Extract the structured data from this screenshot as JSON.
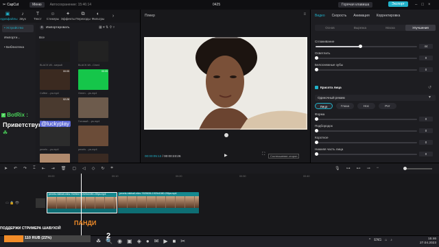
{
  "titlebar": {
    "logo": "CapCut",
    "menu": "Меню",
    "autosave": "Автосохранение: 15:46:14",
    "project": "0425",
    "shortcuts": "Горячая клавиша",
    "export": "Экспорт"
  },
  "tooltabs": [
    {
      "icon": "media-icon",
      "glyph": "▣",
      "label": "Медиафайлы"
    },
    {
      "icon": "audio-icon",
      "glyph": "♪",
      "label": "Звук"
    },
    {
      "icon": "text-icon",
      "glyph": "T",
      "label": "Текст"
    },
    {
      "icon": "sticker-icon",
      "glyph": "☺",
      "label": "Стикеры"
    },
    {
      "icon": "effects-icon",
      "glyph": "✦",
      "label": "Эффекты"
    },
    {
      "icon": "transitions-icon",
      "glyph": "⧉",
      "label": "Переходы"
    },
    {
      "icon": "filters-icon",
      "glyph": "◐",
      "label": "Фильтры"
    },
    {
      "icon": "more-icon",
      "glyph": "›",
      "label": ""
    }
  ],
  "sidebar": {
    "items": [
      "• Устройство",
      "Импорти...",
      "• Библиотека"
    ]
  },
  "media": {
    "import": "Импортировать",
    "all": "Все",
    "thumbs": [
      {
        "cap": "BLACK.Wi...мерый",
        "dur": "",
        "bg": "#1a1a1a"
      },
      {
        "cap": "BLACK.Wi...Cine4",
        "dur": "",
        "bg": "#222"
      },
      {
        "cap": "Coffee ...ps.mp4",
        "dur": "00:05",
        "bg": "#3b2a20"
      },
      {
        "cap": "Green ...ps.mp4",
        "dur": "00:05",
        "bg": "#15c64a"
      },
      {
        "cap": "Coffee ...ps.mp4",
        "dur": "02:28",
        "bg": "#4a3a2f"
      },
      {
        "cap": "Готовый ...ps.mp4",
        "dur": "",
        "bg": "#6d5b4c"
      },
      {
        "cap": "pexels ...ps.mp4",
        "dur": "",
        "bg": "#2c2c2c"
      },
      {
        "cap": "pexels ...ps.mp4",
        "dur": "",
        "bg": "#6b4c38"
      },
      {
        "cap": "pexels ...ps.mp4",
        "dur": "",
        "bg": "#b08a6d"
      },
      {
        "cap": "pexels ...ps.mp4",
        "dur": "",
        "bg": "#3a2a22"
      }
    ]
  },
  "player": {
    "title": "Плеер",
    "current": "00:00:05:12",
    "total": "00:00:23:26",
    "ratio": "Соотношение сторон"
  },
  "right": {
    "tabs": [
      "Видео",
      "Скорость",
      "Анимация",
      "Корректировка"
    ],
    "subtabs": [
      "Основ",
      "Вырезка",
      "Маска",
      "Улучшения"
    ],
    "smooth_label": "Сглаживание",
    "smooth_value": "44",
    "smooth_pct": 0.44,
    "whiten_label": "Осветлить",
    "whiten_value": "0",
    "teeth_label": "Белоснежные зубы",
    "teeth_value": "0",
    "beauty_label": "Красота лица",
    "mode": "Одиночный режим",
    "facetabs": [
      "Лицо",
      "Глаза",
      "Нос",
      "Рот"
    ],
    "rows": [
      {
        "label": "Форма",
        "value": "0"
      },
      {
        "label": "Подбородок",
        "value": "0"
      },
      {
        "label": "Короткое",
        "value": "0"
      },
      {
        "label": "Нижняя часть лица",
        "value": "0"
      }
    ]
  },
  "timeline": {
    "marks": [
      "00:00",
      "00:10",
      "00:20",
      "00:30",
      "00:40"
    ],
    "clip1": "pexels-mikhail-nilov-7625617-1920x1080-25fps.mp4",
    "clip2": "pexels-mikhail-nilov-7625636-1920x1080-25fps.mp4"
  },
  "overlay": {
    "user": "BotRix :",
    "greet": "Приветствую",
    "mention": "@luckyplay",
    "support": "ПОДДЕРЖИ СТРИМЕРА ШАВУХОЙ",
    "donate": "110 RUB (22%)",
    "donate_pct": 0.22,
    "panda": "ПАНДИ",
    "badge": "2"
  },
  "taskbar": {
    "lang": "ENG",
    "time": "15:46",
    "date": "27.04.2023"
  },
  "colors": {
    "accent": "#21b1c9",
    "clip": "#15898f",
    "donate": "#f28c28",
    "botgreen": "#4ad35a"
  }
}
